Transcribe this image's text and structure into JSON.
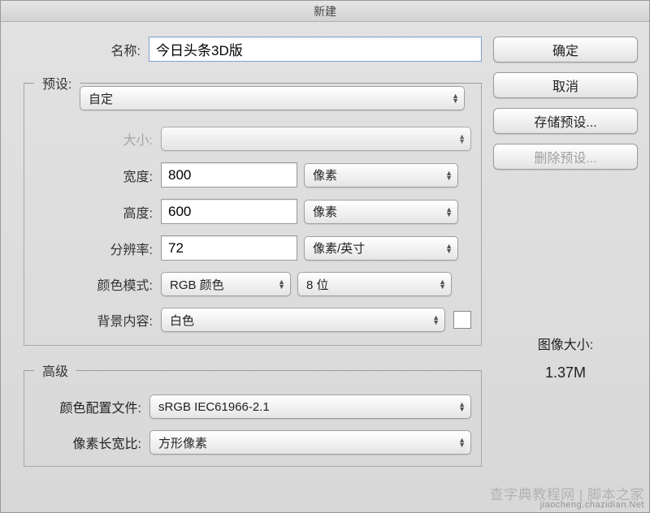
{
  "dialog_title": "新建",
  "name_label": "名称:",
  "name_value": "今日头条3D版",
  "preset_label": "预设:",
  "preset_value": "自定",
  "size_label": "大小:",
  "size_value": "",
  "width_label": "宽度:",
  "width_value": "800",
  "width_unit": "像素",
  "height_label": "高度:",
  "height_value": "600",
  "height_unit": "像素",
  "resolution_label": "分辨率:",
  "resolution_value": "72",
  "resolution_unit": "像素/英寸",
  "colormode_label": "颜色模式:",
  "colormode_value": "RGB 颜色",
  "bitdepth_value": "8 位",
  "bgcontent_label": "背景内容:",
  "bgcontent_value": "白色",
  "bgcontent_color": "#ffffff",
  "advanced_legend": "高级",
  "colorprofile_label": "颜色配置文件:",
  "colorprofile_value": "sRGB IEC61966-2.1",
  "aspectratio_label": "像素长宽比:",
  "aspectratio_value": "方形像素",
  "buttons": {
    "ok": "确定",
    "cancel": "取消",
    "save_preset": "存储预设...",
    "delete_preset": "删除预设..."
  },
  "image_size_label": "图像大小:",
  "image_size_value": "1.37M",
  "watermark": {
    "line1": "查字典教程网 | 脚本之家",
    "line2": "jiaocheng.chazidian.Net"
  }
}
